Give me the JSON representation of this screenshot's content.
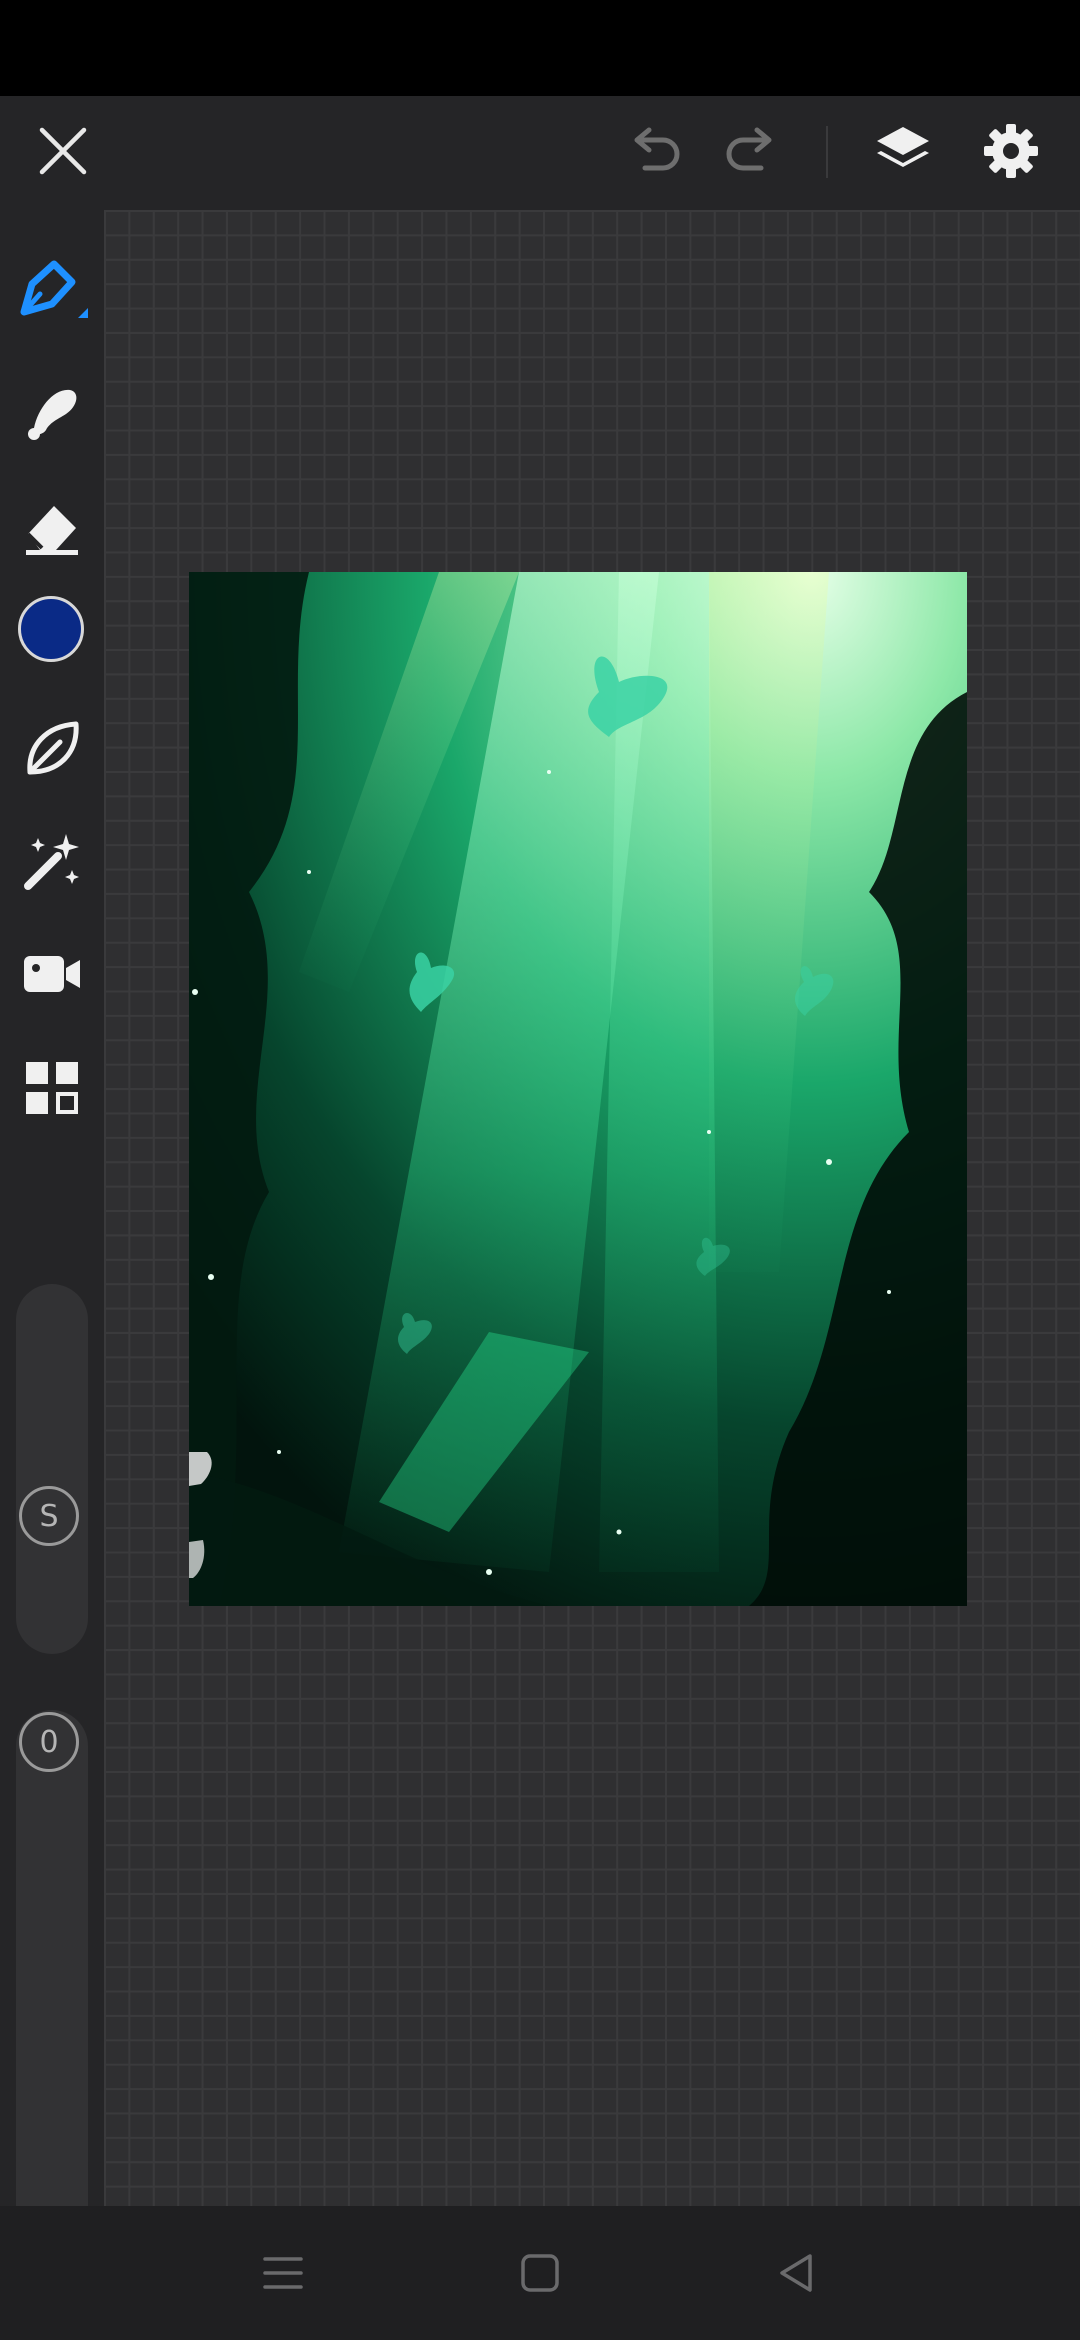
{
  "app": {
    "name": "drawing canvas"
  },
  "toolbar": {
    "close_icon": "close-icon",
    "undo_icon": "undo-icon",
    "redo_icon": "redo-icon",
    "layers_icon": "layers-icon",
    "settings_icon": "gear-icon"
  },
  "tools": [
    {
      "name": "pen",
      "icon": "pen-icon",
      "active": true
    },
    {
      "name": "smudge",
      "icon": "smudge-icon"
    },
    {
      "name": "eraser",
      "icon": "eraser-icon"
    },
    {
      "name": "color",
      "icon": "color-swatch",
      "color": "#0a2a86"
    },
    {
      "name": "leaf",
      "icon": "leaf-icon"
    },
    {
      "name": "magic",
      "icon": "magic-wand-icon"
    },
    {
      "name": "video",
      "icon": "video-icon"
    },
    {
      "name": "gallery",
      "icon": "grid-icon"
    }
  ],
  "sliders": {
    "size_label": "S",
    "opacity_label": "0"
  },
  "colors": {
    "accent": "#1e90ff",
    "selected_color": "#0a2a86"
  },
  "navbar": {
    "menu_icon": "menu-icon",
    "home_icon": "home-square-icon",
    "back_icon": "back-triangle-icon"
  }
}
